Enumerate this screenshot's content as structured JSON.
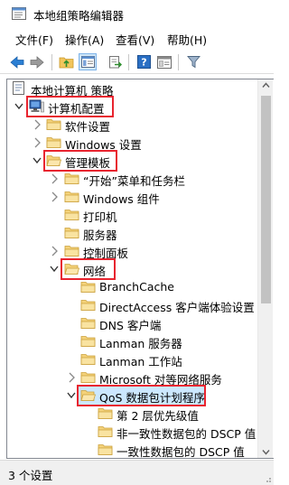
{
  "window": {
    "title": "本地组策略编辑器"
  },
  "menu": [
    "文件(F)",
    "操作(A)",
    "查看(V)",
    "帮助(H)"
  ],
  "toolbar": {
    "buttons": [
      "back-icon",
      "forward-icon",
      "up-folder-icon",
      "show-hide-tree-icon",
      "export-list-icon",
      "help-icon",
      "properties-icon",
      "filter-icon"
    ]
  },
  "tree": {
    "root": "本地计算机 策略",
    "computer_config": "计算机配置",
    "software_settings": "软件设置",
    "windows_settings": "Windows 设置",
    "admin_templates": "管理模板",
    "start_menu": "“开始”菜单和任务栏",
    "windows_components": "Windows 组件",
    "printers": "打印机",
    "servers": "服务器",
    "control_panel": "控制面板",
    "network": "网络",
    "branchcache": "BranchCache",
    "directaccess": "DirectAccess 客户端体验设置",
    "dns_client": "DNS 客户端",
    "lanman_server": "Lanman 服务器",
    "lanman_workstation": "Lanman 工作站",
    "ms_peer": "Microsoft 对等网络服务",
    "qos": "QoS 数据包计划程序",
    "layer2": "第 2 层优先级值",
    "dscp_nonconform": "非一致性数据包的 DSCP 值",
    "dscp_conform": "一致性数据包的 DSCP 值"
  },
  "status": {
    "text": "3 个设置"
  },
  "highlight_color": "#e8242f"
}
